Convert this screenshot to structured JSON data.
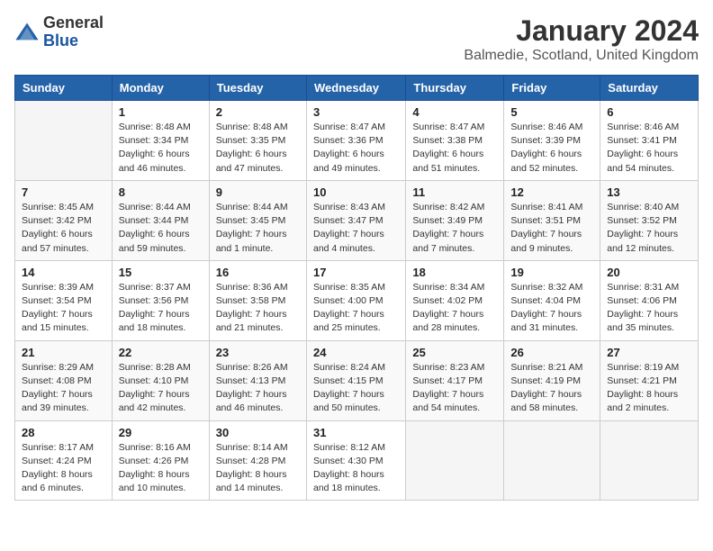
{
  "logo": {
    "general": "General",
    "blue": "Blue"
  },
  "title": "January 2024",
  "location": "Balmedie, Scotland, United Kingdom",
  "days_of_week": [
    "Sunday",
    "Monday",
    "Tuesday",
    "Wednesday",
    "Thursday",
    "Friday",
    "Saturday"
  ],
  "weeks": [
    [
      {
        "day": "",
        "info": ""
      },
      {
        "day": "1",
        "info": "Sunrise: 8:48 AM\nSunset: 3:34 PM\nDaylight: 6 hours\nand 46 minutes."
      },
      {
        "day": "2",
        "info": "Sunrise: 8:48 AM\nSunset: 3:35 PM\nDaylight: 6 hours\nand 47 minutes."
      },
      {
        "day": "3",
        "info": "Sunrise: 8:47 AM\nSunset: 3:36 PM\nDaylight: 6 hours\nand 49 minutes."
      },
      {
        "day": "4",
        "info": "Sunrise: 8:47 AM\nSunset: 3:38 PM\nDaylight: 6 hours\nand 51 minutes."
      },
      {
        "day": "5",
        "info": "Sunrise: 8:46 AM\nSunset: 3:39 PM\nDaylight: 6 hours\nand 52 minutes."
      },
      {
        "day": "6",
        "info": "Sunrise: 8:46 AM\nSunset: 3:41 PM\nDaylight: 6 hours\nand 54 minutes."
      }
    ],
    [
      {
        "day": "7",
        "info": "Sunrise: 8:45 AM\nSunset: 3:42 PM\nDaylight: 6 hours\nand 57 minutes."
      },
      {
        "day": "8",
        "info": "Sunrise: 8:44 AM\nSunset: 3:44 PM\nDaylight: 6 hours\nand 59 minutes."
      },
      {
        "day": "9",
        "info": "Sunrise: 8:44 AM\nSunset: 3:45 PM\nDaylight: 7 hours\nand 1 minute."
      },
      {
        "day": "10",
        "info": "Sunrise: 8:43 AM\nSunset: 3:47 PM\nDaylight: 7 hours\nand 4 minutes."
      },
      {
        "day": "11",
        "info": "Sunrise: 8:42 AM\nSunset: 3:49 PM\nDaylight: 7 hours\nand 7 minutes."
      },
      {
        "day": "12",
        "info": "Sunrise: 8:41 AM\nSunset: 3:51 PM\nDaylight: 7 hours\nand 9 minutes."
      },
      {
        "day": "13",
        "info": "Sunrise: 8:40 AM\nSunset: 3:52 PM\nDaylight: 7 hours\nand 12 minutes."
      }
    ],
    [
      {
        "day": "14",
        "info": "Sunrise: 8:39 AM\nSunset: 3:54 PM\nDaylight: 7 hours\nand 15 minutes."
      },
      {
        "day": "15",
        "info": "Sunrise: 8:37 AM\nSunset: 3:56 PM\nDaylight: 7 hours\nand 18 minutes."
      },
      {
        "day": "16",
        "info": "Sunrise: 8:36 AM\nSunset: 3:58 PM\nDaylight: 7 hours\nand 21 minutes."
      },
      {
        "day": "17",
        "info": "Sunrise: 8:35 AM\nSunset: 4:00 PM\nDaylight: 7 hours\nand 25 minutes."
      },
      {
        "day": "18",
        "info": "Sunrise: 8:34 AM\nSunset: 4:02 PM\nDaylight: 7 hours\nand 28 minutes."
      },
      {
        "day": "19",
        "info": "Sunrise: 8:32 AM\nSunset: 4:04 PM\nDaylight: 7 hours\nand 31 minutes."
      },
      {
        "day": "20",
        "info": "Sunrise: 8:31 AM\nSunset: 4:06 PM\nDaylight: 7 hours\nand 35 minutes."
      }
    ],
    [
      {
        "day": "21",
        "info": "Sunrise: 8:29 AM\nSunset: 4:08 PM\nDaylight: 7 hours\nand 39 minutes."
      },
      {
        "day": "22",
        "info": "Sunrise: 8:28 AM\nSunset: 4:10 PM\nDaylight: 7 hours\nand 42 minutes."
      },
      {
        "day": "23",
        "info": "Sunrise: 8:26 AM\nSunset: 4:13 PM\nDaylight: 7 hours\nand 46 minutes."
      },
      {
        "day": "24",
        "info": "Sunrise: 8:24 AM\nSunset: 4:15 PM\nDaylight: 7 hours\nand 50 minutes."
      },
      {
        "day": "25",
        "info": "Sunrise: 8:23 AM\nSunset: 4:17 PM\nDaylight: 7 hours\nand 54 minutes."
      },
      {
        "day": "26",
        "info": "Sunrise: 8:21 AM\nSunset: 4:19 PM\nDaylight: 7 hours\nand 58 minutes."
      },
      {
        "day": "27",
        "info": "Sunrise: 8:19 AM\nSunset: 4:21 PM\nDaylight: 8 hours\nand 2 minutes."
      }
    ],
    [
      {
        "day": "28",
        "info": "Sunrise: 8:17 AM\nSunset: 4:24 PM\nDaylight: 8 hours\nand 6 minutes."
      },
      {
        "day": "29",
        "info": "Sunrise: 8:16 AM\nSunset: 4:26 PM\nDaylight: 8 hours\nand 10 minutes."
      },
      {
        "day": "30",
        "info": "Sunrise: 8:14 AM\nSunset: 4:28 PM\nDaylight: 8 hours\nand 14 minutes."
      },
      {
        "day": "31",
        "info": "Sunrise: 8:12 AM\nSunset: 4:30 PM\nDaylight: 8 hours\nand 18 minutes."
      },
      {
        "day": "",
        "info": ""
      },
      {
        "day": "",
        "info": ""
      },
      {
        "day": "",
        "info": ""
      }
    ]
  ]
}
